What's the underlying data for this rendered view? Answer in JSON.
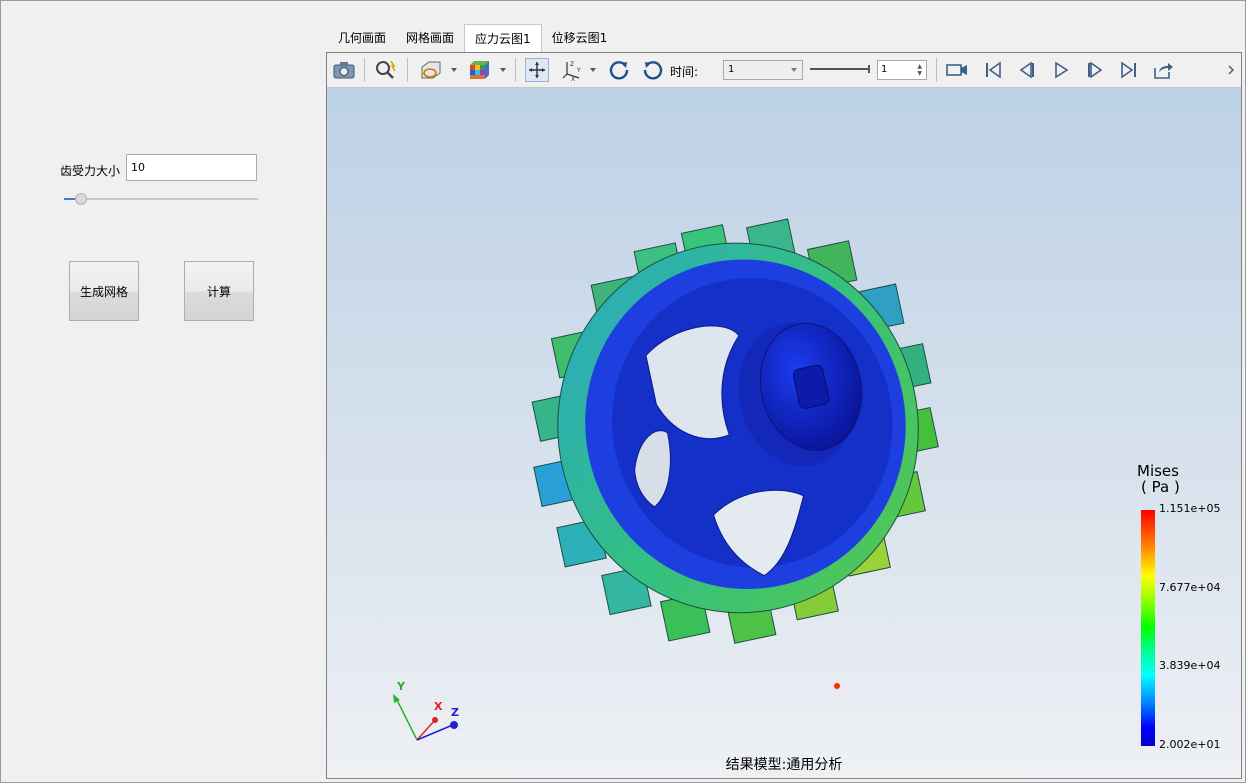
{
  "left_panel": {
    "force_label": "齿受力大小",
    "force_value": "10",
    "slider_value": 0.08,
    "mesh_button": "生成网格",
    "compute_button": "计算"
  },
  "tabs": [
    {
      "label": "几何画面",
      "active": false
    },
    {
      "label": "网格画面",
      "active": false
    },
    {
      "label": "应力云图1",
      "active": true
    },
    {
      "label": "位移云图1",
      "active": false
    }
  ],
  "toolbar": {
    "icons": [
      "camera-icon",
      "zoom-icon",
      "display-style-icon",
      "colormap-icon",
      "fit-view-icon",
      "axes-icon",
      "rotate-left-icon",
      "rotate-right-icon",
      "record-icon",
      "first-frame-icon",
      "prev-frame-icon",
      "play-icon",
      "next-frame-icon",
      "last-frame-icon",
      "export-icon"
    ],
    "time_label": "时间:",
    "time_value": "1",
    "step_value": "1"
  },
  "legend": {
    "title_line1": "Mises",
    "title_line2": "( Pa )",
    "values": [
      "1.151e+05",
      "7.677e+04",
      "3.839e+04",
      "2.002e+01"
    ]
  },
  "axes": {
    "x": "X",
    "y": "Y",
    "z": "Z"
  },
  "result_label": "结果模型:通用分析",
  "colors": {
    "accent": "#3b7fd4",
    "mesh_low": "#0a1ccf",
    "mesh_high": "#ff0000"
  }
}
